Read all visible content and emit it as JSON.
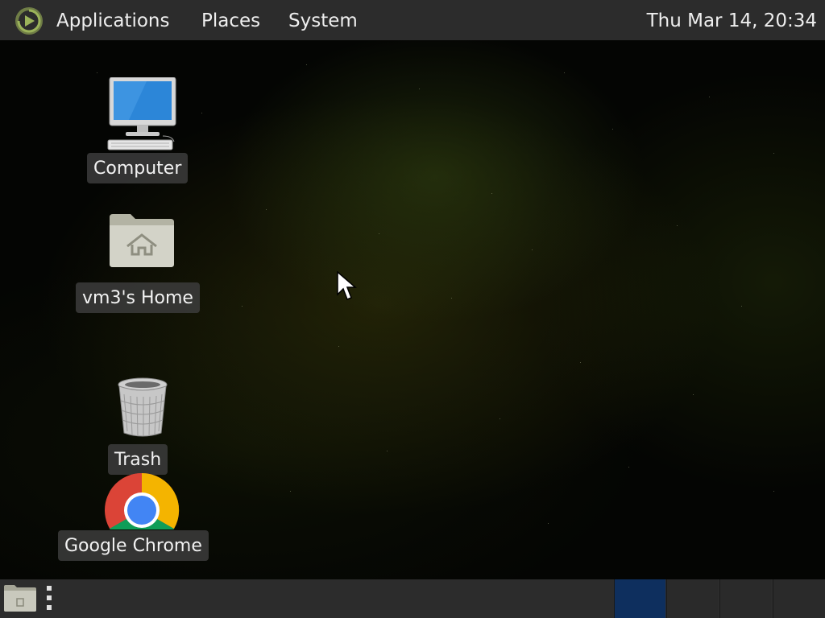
{
  "top_panel": {
    "menu_logo_icon": "mate-menu-logo-icon",
    "applications_label": "Applications",
    "places_label": "Places",
    "system_label": "System",
    "clock": "Thu Mar 14, 20:34"
  },
  "desktop": {
    "icons": [
      {
        "label": "Computer",
        "icon": "computer-icon"
      },
      {
        "label": "vm3's Home",
        "icon": "home-folder-icon"
      },
      {
        "label": "Trash",
        "icon": "trash-icon"
      },
      {
        "label": "Google Chrome",
        "icon": "chrome-icon"
      }
    ]
  },
  "bottom_panel": {
    "show_desktop_icon": "show-desktop-icon",
    "workspace_active_index": 0,
    "workspace_count": 4,
    "colors": {
      "panel": "#2c2c2c",
      "workspace_active": "#0e2f5e"
    }
  }
}
